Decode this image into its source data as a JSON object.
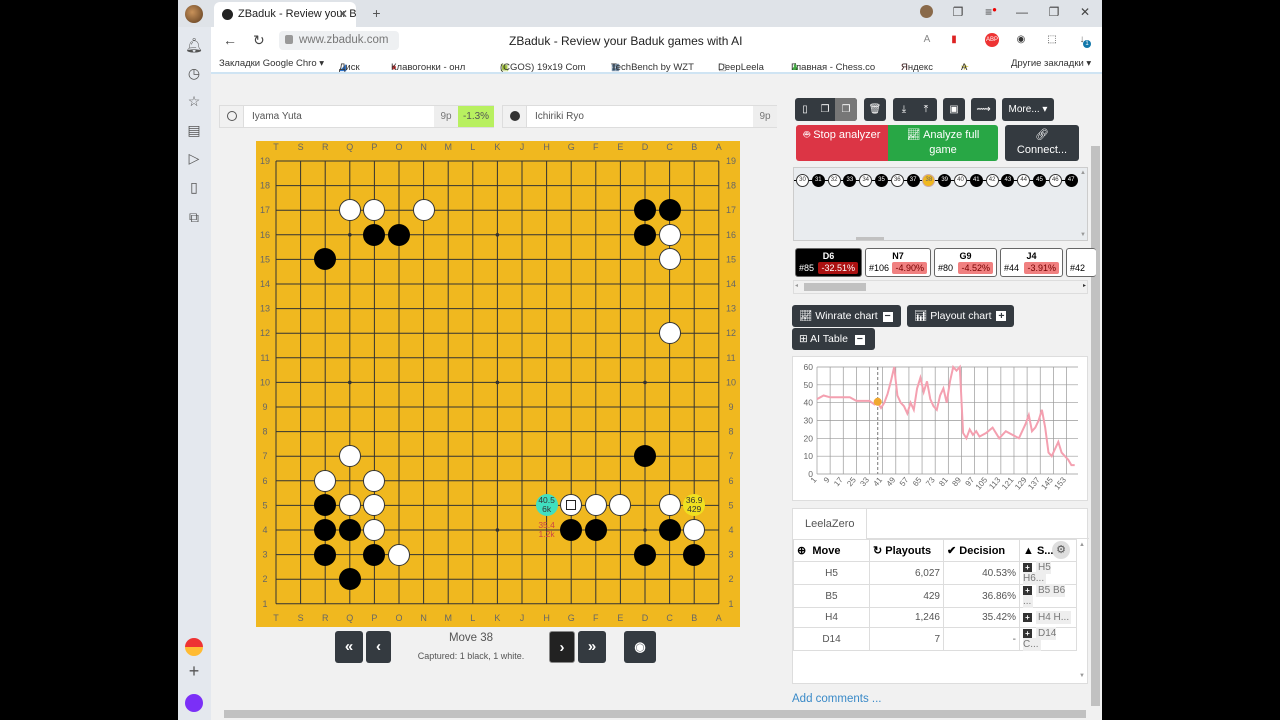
{
  "browser": {
    "tab_title": "ZBaduk - Review your B",
    "url": "www.zbaduk.com",
    "page_title": "ZBaduk - Review your Baduk games with AI",
    "bookmarks": [
      "Закладки Google Chro ▾",
      "Диск",
      "Клавогонки - онл",
      "(CGOS) 19x19 Com",
      "TechBench by WZT",
      "DeepLeela",
      "Главная - Chess.co",
      "Яндекс",
      "А"
    ],
    "other_bookmarks": "Другие закладки ▾",
    "download_badge": "1"
  },
  "players": {
    "white": {
      "name": "Iyama Yuta",
      "rank": "9p",
      "delta": "-1.3%"
    },
    "black": {
      "name": "Ichiriki Ryo",
      "rank": "9p"
    }
  },
  "board": {
    "columns": [
      "T",
      "S",
      "R",
      "Q",
      "P",
      "O",
      "N",
      "M",
      "L",
      "K",
      "J",
      "H",
      "G",
      "F",
      "E",
      "D",
      "C",
      "B",
      "A"
    ],
    "rows": [
      "19",
      "18",
      "17",
      "16",
      "15",
      "14",
      "13",
      "12",
      "11",
      "10",
      "9",
      "8",
      "7",
      "6",
      "5",
      "4",
      "3",
      "2",
      "1"
    ],
    "white_stones": [
      "Q17",
      "P17",
      "N17",
      "C16",
      "C15",
      "C12",
      "Q7",
      "R6",
      "P6",
      "Q5",
      "P5",
      "P4",
      "O3",
      "G5",
      "F5",
      "E5",
      "C5",
      "B4"
    ],
    "black_stones": [
      "P16",
      "O16",
      "R15",
      "D17",
      "C17",
      "D16",
      "D7",
      "R5",
      "R4",
      "Q4",
      "R3",
      "P3",
      "Q2",
      "G4",
      "F4",
      "C4",
      "D3",
      "B3"
    ],
    "last_move": "G5",
    "hints": [
      {
        "point": "H5",
        "winrate": "40.5",
        "playouts": "6k",
        "color": "#40e0c0"
      },
      {
        "point": "B5",
        "winrate": "36.9",
        "playouts": "429",
        "color": "#f0e020"
      },
      {
        "point": "H4",
        "winrate": "35.4",
        "playouts": "1.2k",
        "color": ""
      }
    ]
  },
  "navigation": {
    "move_label": "Move 38",
    "captured": "Captured: 1 black, 1 white.",
    "first": "«",
    "prev": "‹",
    "next": "›",
    "last": "»"
  },
  "toolbar": {
    "more": "More...",
    "stop_analyzer": "Stop analyzer",
    "analyze_full": "Analyze full game",
    "connect": "Connect..."
  },
  "move_list": {
    "moves": [
      30,
      31,
      32,
      33,
      34,
      35,
      36,
      37,
      38,
      39,
      40,
      41,
      42,
      43,
      44,
      45,
      46,
      47
    ],
    "current": 38
  },
  "mistakes": [
    {
      "move": "D6",
      "num": "#85",
      "pct": "-32.51%"
    },
    {
      "move": "N7",
      "num": "#106",
      "pct": "-4.90%"
    },
    {
      "move": "G9",
      "num": "#80",
      "pct": "-4.52%"
    },
    {
      "move": "J4",
      "num": "#44",
      "pct": "-3.91%"
    },
    {
      "move": "",
      "num": "#42",
      "pct": ""
    }
  ],
  "panels": {
    "winrate_chart": "Winrate chart",
    "playout_chart": "Playout chart",
    "ai_table": "AI Table"
  },
  "chart_data": {
    "type": "line",
    "title": "",
    "ylim": [
      0,
      60
    ],
    "yticks": [
      0,
      10,
      20,
      30,
      40,
      50,
      60
    ],
    "xticks": [
      "1",
      "9",
      "17",
      "25",
      "33",
      "41",
      "49",
      "57",
      "65",
      "73",
      "81",
      "89",
      "97",
      "105",
      "113",
      "121",
      "129",
      "137",
      "145",
      "153"
    ],
    "current_move": 38,
    "current_value": 40.5,
    "series": [
      {
        "name": "winrate",
        "color": "#f4a0b0",
        "x": [
          1,
          5,
          9,
          13,
          17,
          21,
          25,
          29,
          33,
          36,
          38,
          40,
          42,
          44,
          46,
          48,
          50,
          52,
          54,
          56,
          58,
          60,
          62,
          64,
          66,
          68,
          70,
          72,
          74,
          76,
          78,
          80,
          82,
          84,
          86,
          88,
          90,
          92,
          94,
          96,
          98,
          100,
          104,
          108,
          112,
          116,
          120,
          124,
          128,
          130,
          132,
          134,
          136,
          138,
          140,
          142,
          144,
          146,
          148,
          150,
          152,
          154,
          156,
          158
        ],
        "values": [
          42,
          44,
          43,
          43,
          43,
          43,
          41,
          41,
          41,
          39,
          40,
          37,
          40,
          45,
          52,
          60,
          44,
          40,
          38,
          34,
          40,
          36,
          48,
          54,
          46,
          52,
          42,
          38,
          36,
          44,
          48,
          40,
          52,
          60,
          58,
          60,
          23,
          20,
          25,
          22,
          24,
          21,
          23,
          26,
          20,
          24,
          22,
          20,
          28,
          33,
          24,
          26,
          30,
          36,
          26,
          12,
          10,
          14,
          18,
          12,
          10,
          8,
          5,
          5
        ]
      }
    ]
  },
  "ai": {
    "engine_tab": "LeelaZero",
    "columns": [
      "Move",
      "Playouts",
      "Decision",
      "S..."
    ],
    "rows": [
      {
        "move": "H5",
        "playouts": "6,027",
        "decision": "40.53%",
        "pv": "H5 H6..."
      },
      {
        "move": "B5",
        "playouts": "429",
        "decision": "36.86%",
        "pv": "B5 B6 ..."
      },
      {
        "move": "H4",
        "playouts": "1,246",
        "decision": "35.42%",
        "pv": "H4 H..."
      },
      {
        "move": "D14",
        "playouts": "7",
        "decision": "-",
        "pv": "D14 C..."
      }
    ]
  },
  "comments_link": "Add comments ..."
}
